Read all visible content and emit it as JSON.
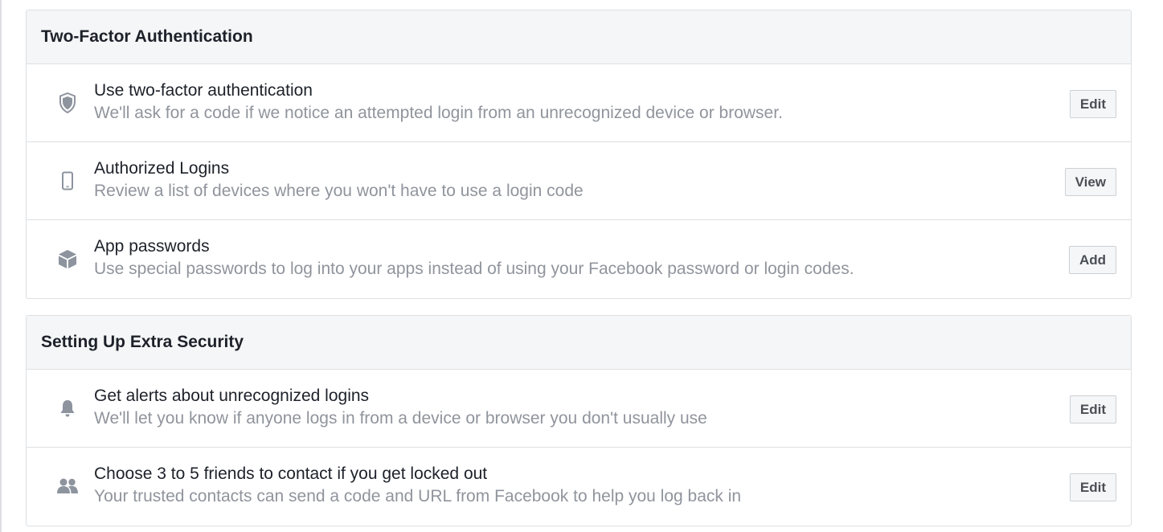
{
  "sections": [
    {
      "title": "Two-Factor Authentication",
      "rows": [
        {
          "icon": "shield-icon",
          "title": "Use two-factor authentication",
          "description": "We'll ask for a code if we notice an attempted login from an unrecognized device or browser.",
          "button": "Edit"
        },
        {
          "icon": "phone-icon",
          "title": "Authorized Logins",
          "description": "Review a list of devices where you won't have to use a login code",
          "button": "View"
        },
        {
          "icon": "box-icon",
          "title": "App passwords",
          "description": "Use special passwords to log into your apps instead of using your Facebook password or login codes.",
          "button": "Add"
        }
      ]
    },
    {
      "title": "Setting Up Extra Security",
      "rows": [
        {
          "icon": "bell-icon",
          "title": "Get alerts about unrecognized logins",
          "description": "We'll let you know if anyone logs in from a device or browser you don't usually use",
          "button": "Edit"
        },
        {
          "icon": "friends-icon",
          "title": "Choose 3 to 5 friends to contact if you get locked out",
          "description": "Your trusted contacts can send a code and URL from Facebook to help you log back in",
          "button": "Edit"
        }
      ]
    }
  ],
  "colors": {
    "header_bg": "#f5f6f7",
    "border": "#dddfe2",
    "title_text": "#1d2129",
    "secondary_text": "#90949c",
    "icon": "#8d949e"
  }
}
